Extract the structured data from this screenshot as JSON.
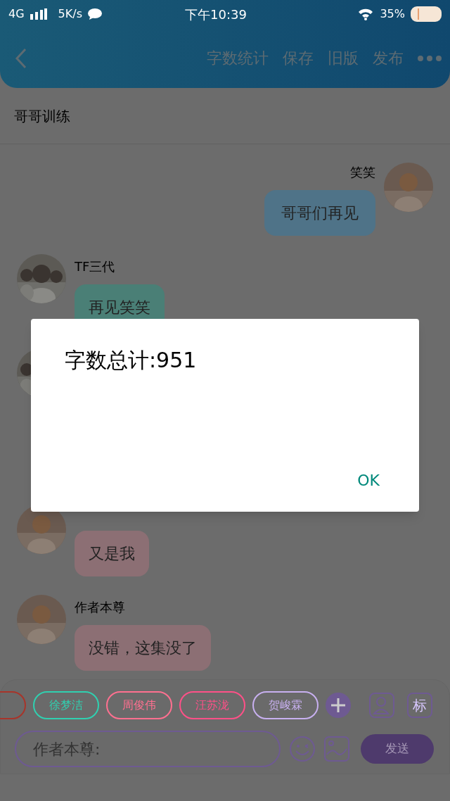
{
  "status_bar": {
    "network": "4G",
    "speed": "5K/s",
    "time": "下午10:39",
    "battery": "35%"
  },
  "header": {
    "actions": [
      "字数统计",
      "保存",
      "旧版",
      "发布"
    ]
  },
  "chat_title": "哥哥训练",
  "messages": [
    {
      "kind": "outgoing",
      "author": "笑笑",
      "text": "哥哥们再见",
      "color": "#4f7388"
    },
    {
      "kind": "incoming",
      "author": "TF三代",
      "text": "再见笑笑",
      "color": "#4a7f76"
    },
    {
      "kind": "covered"
    },
    {
      "kind": "incoming",
      "text": "又是我",
      "color": "#8c6f74"
    },
    {
      "kind": "incoming",
      "author": "作者本尊",
      "text": "没错，这集没了",
      "color": "#8c6f74"
    }
  ],
  "dialog": {
    "message": "字数总计:951",
    "button": "OK"
  },
  "tags": [
    {
      "kind": "cut",
      "color": "#a8342a"
    },
    {
      "label": "徐梦洁",
      "color": "#30d0b0"
    },
    {
      "label": "周俊伟",
      "color": "#ff7090"
    },
    {
      "label": "汪苏泷",
      "color": "#ff5088"
    },
    {
      "label": "贺峻霖",
      "color": "#c8b0f0"
    }
  ],
  "input": {
    "placeholder": "作者本尊:"
  },
  "toolbar": {
    "tag_button": "标",
    "send": "发送"
  }
}
